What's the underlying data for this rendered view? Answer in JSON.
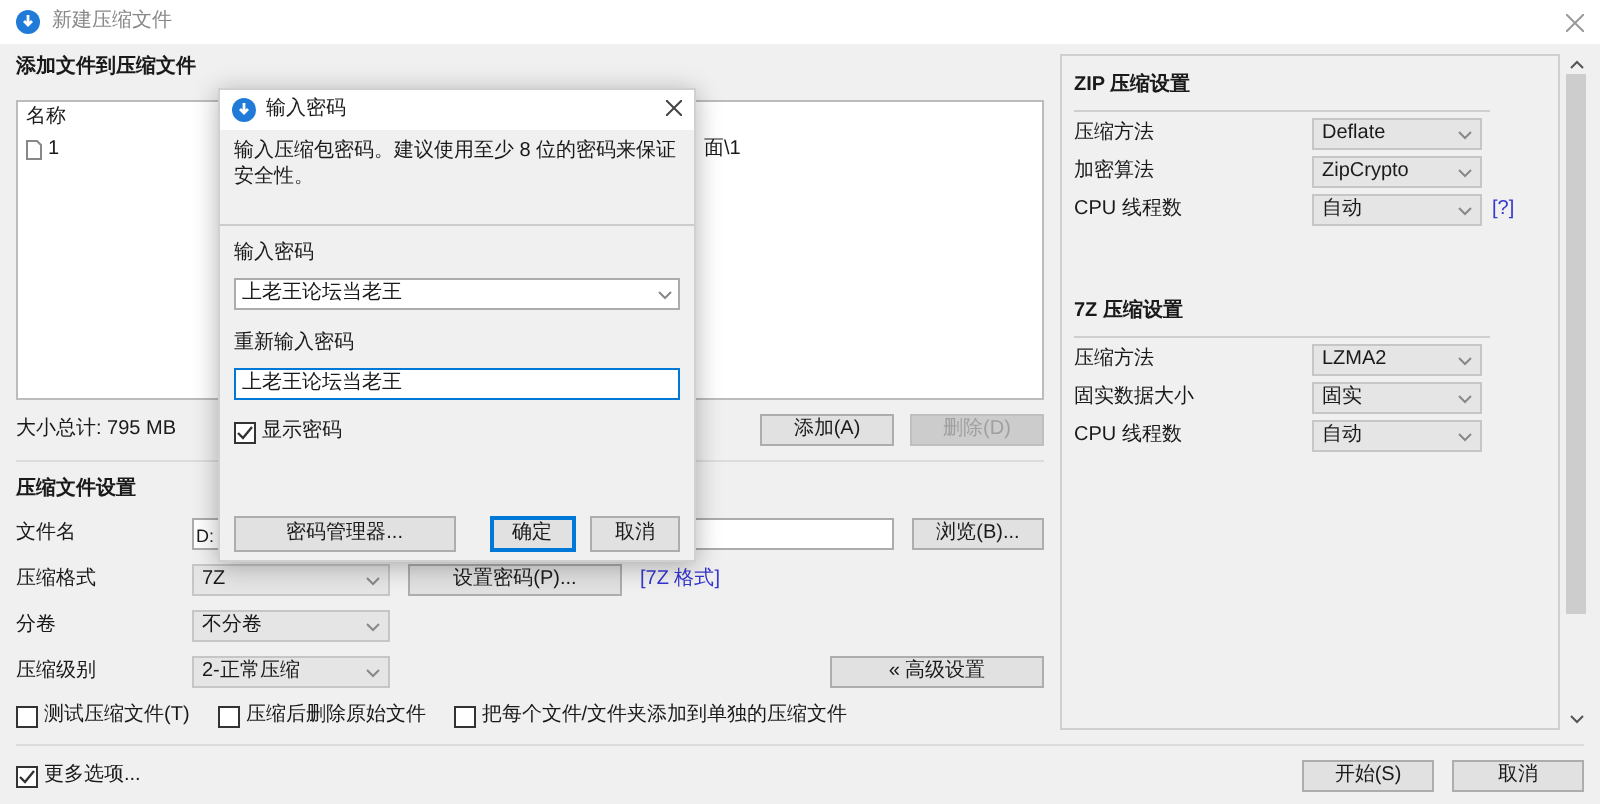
{
  "window": {
    "title": "新建压缩文件"
  },
  "files": {
    "title": "添加文件到压缩文件",
    "column": "名称",
    "rows": [
      {
        "name": "1",
        "path": "面\\1"
      }
    ],
    "total": "大小总计: 795 MB",
    "buttons": [
      {
        "label": "添加(A)",
        "disabled": false
      },
      {
        "label": "删除(D)",
        "disabled": true
      }
    ]
  },
  "settings": {
    "title": "压缩文件设置",
    "rows": [
      {
        "kind": "text",
        "label": "文件名",
        "value": "D:",
        "button": "浏览(B)..."
      },
      {
        "kind": "select",
        "label": "压缩格式",
        "value": "7Z",
        "button": "设置密码(P)...",
        "link": "[7Z 格式]"
      },
      {
        "kind": "select",
        "label": "分卷",
        "value": "不分卷"
      },
      {
        "kind": "select",
        "label": "压缩级别",
        "value": "2-正常压缩",
        "button": "« 高级设置"
      }
    ],
    "options": [
      {
        "label": "测试压缩文件(T)",
        "checked": false
      },
      {
        "label": "压缩后删除原始文件",
        "checked": false
      },
      {
        "label": "把每个文件/文件夹添加到单独的压缩文件",
        "checked": false
      }
    ]
  },
  "side_panel": [
    {
      "title": "ZIP 压缩设置",
      "rows": [
        {
          "label": "压缩方法",
          "value": "Deflate"
        },
        {
          "label": "加密算法",
          "value": "ZipCrypto"
        },
        {
          "label": "CPU 线程数",
          "value": "自动",
          "link": "[?]"
        }
      ]
    },
    {
      "title": "7Z 压缩设置",
      "rows": [
        {
          "label": "压缩方法",
          "value": "LZMA2"
        },
        {
          "label": "固实数据大小",
          "value": "固实"
        },
        {
          "label": "CPU 线程数",
          "value": "自动"
        }
      ]
    }
  ],
  "more_options": {
    "label": "更多选项...",
    "checked": true
  },
  "footer_buttons": [
    "开始(S)",
    "取消"
  ],
  "dialog": {
    "title": "输入密码",
    "message": "输入压缩包密码。建议使用至少 8 位的密码来保证安全性。",
    "password": {
      "label": "输入密码",
      "value": "上老王论坛当老王"
    },
    "confirm": {
      "label": "重新输入密码",
      "value": "上老王论坛当老王",
      "focused": true
    },
    "show_password": {
      "label": "显示密码",
      "checked": true
    },
    "buttons": [
      {
        "label": "密码管理器...",
        "default": false
      },
      {
        "label": "确定",
        "default": true
      },
      {
        "label": "取消",
        "default": false
      }
    ]
  }
}
